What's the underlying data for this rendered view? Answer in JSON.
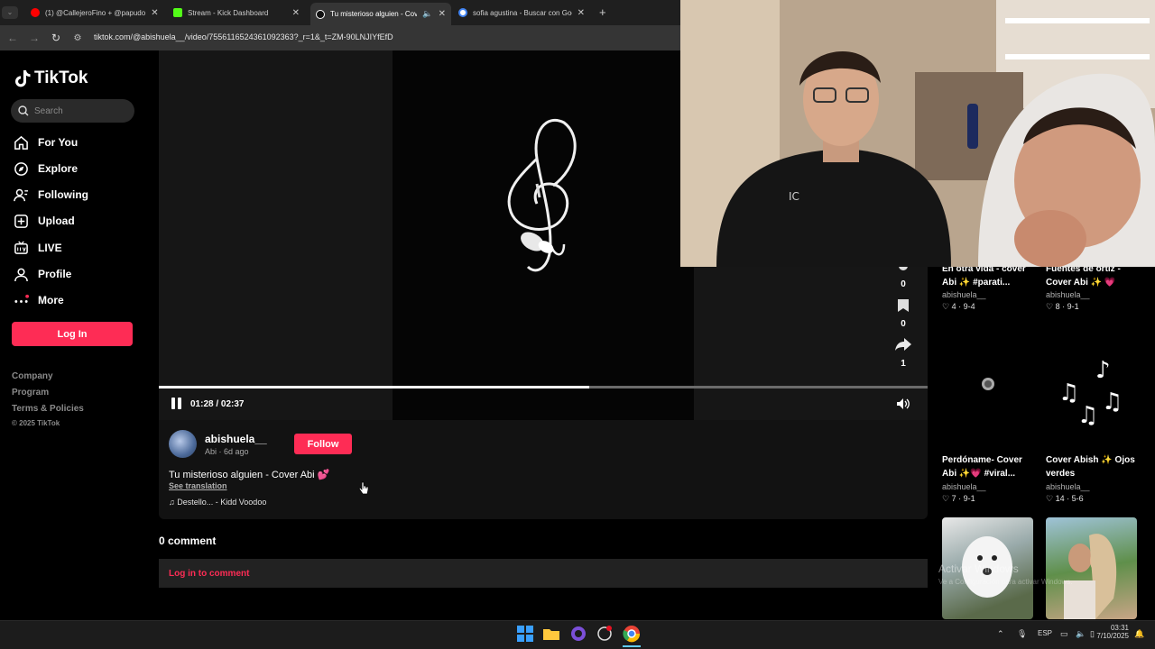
{
  "browser": {
    "tabs": [
      {
        "title": "(1) @CallejeroFino + @papudo",
        "color": "#ff0000"
      },
      {
        "title": "Stream - Kick Dashboard",
        "color": "#53fc18"
      },
      {
        "title": "Tu misterioso alguien - Cov",
        "color": "#ffffff"
      },
      {
        "title": "sofia agustina - Buscar con Goo",
        "color": "#4285f4"
      }
    ],
    "new_tab": "+",
    "url": "tiktok.com/@abishuela__/video/7556116524361092363?_r=1&_t=ZM-90LNJIYfEfD"
  },
  "tiktok": {
    "logo": "TikTok",
    "search_placeholder": "Search",
    "nav": [
      {
        "label": "For You",
        "icon": "home-icon"
      },
      {
        "label": "Explore",
        "icon": "compass-icon"
      },
      {
        "label": "Following",
        "icon": "following-icon"
      },
      {
        "label": "Upload",
        "icon": "upload-icon"
      },
      {
        "label": "LIVE",
        "icon": "live-icon"
      },
      {
        "label": "Profile",
        "icon": "profile-icon"
      },
      {
        "label": "More",
        "icon": "more-icon"
      }
    ],
    "login": "Log In",
    "footer": [
      "Company",
      "Program",
      "Terms & Policies"
    ],
    "copyright": "© 2025 TikTok"
  },
  "video": {
    "time": "01:28 / 02:37",
    "progress": 0.56,
    "actions": {
      "likes": "0",
      "saves": "0",
      "shares": "1"
    },
    "author": "abishuela__",
    "meta": "Abi · 6d ago",
    "follow": "Follow",
    "caption": "Tu misterioso alguien - Cover Abi",
    "see_translation": "See translation",
    "music": "Destello... - Kidd Voodoo"
  },
  "comments": {
    "count": "0 comment",
    "login_prompt": "Log in to comment"
  },
  "related": [
    {
      "title1": "En otra vida - cover",
      "title2": "Abi ✨ #parati...",
      "author": "abishuela__",
      "stats": "4 · 9-4"
    },
    {
      "title1": "Fuentes de ortiz -",
      "title2": "Cover Abi ✨ 💗",
      "author": "abishuela__",
      "stats": "8 · 9-1"
    },
    {
      "title1": "Perdóname- Cover",
      "title2": "Abi ✨💗 #viral...",
      "author": "abishuela__",
      "stats": "7 · 9-1"
    },
    {
      "title1": "Cover Abish ✨ Ojos",
      "title2": "verdes",
      "author": "abishuela__",
      "stats": "14 · 5-6"
    }
  ],
  "watermark": {
    "line1": "Activar Windows",
    "line2": "Ve a Configuración para activar Windows."
  },
  "taskbar": {
    "lang": "ESP",
    "time": "03:31",
    "date": "7/10/2025"
  }
}
